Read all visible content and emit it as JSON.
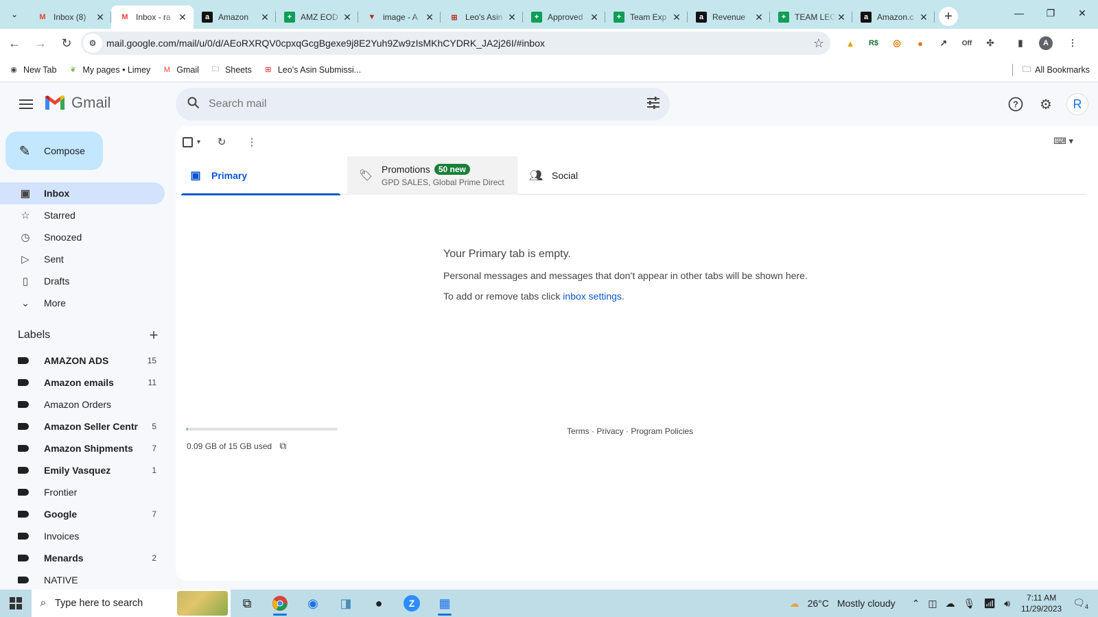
{
  "browser": {
    "tabs": [
      {
        "title": "Inbox (8)",
        "icon": "gmail-icon"
      },
      {
        "title": "Inbox - ra",
        "icon": "gmail-icon",
        "active": true
      },
      {
        "title": "Amazon",
        "icon": "amazon-icon"
      },
      {
        "title": "AMZ EOD",
        "icon": "sheets-icon"
      },
      {
        "title": "image - A",
        "icon": "vivaldi-icon"
      },
      {
        "title": "Leo's Asin",
        "icon": "form-icon"
      },
      {
        "title": "Approved",
        "icon": "sheets-icon"
      },
      {
        "title": "Team Exp",
        "icon": "sheets-icon"
      },
      {
        "title": "Revenue",
        "icon": "amazon-icon"
      },
      {
        "title": "TEAM LEO",
        "icon": "sheets-icon"
      },
      {
        "title": "Amazon.c",
        "icon": "amazon-icon"
      }
    ],
    "url": "mail.google.com/mail/u/0/d/AEoRXRQV0cpxqGcgBgexe9j8E2Yuh9Zw9zIsMKhCYDRK_JA2j26I/#inbox",
    "bookmarks": [
      {
        "label": "New Tab",
        "icon": "chrome-icon"
      },
      {
        "label": "My pages • Limey",
        "icon": "limey-icon"
      },
      {
        "label": "Gmail",
        "icon": "gmail-icon"
      },
      {
        "label": "Sheets",
        "icon": "folder-icon"
      },
      {
        "label": "Leo's Asin Submissi...",
        "icon": "form-icon"
      }
    ],
    "all_bookmarks": "All Bookmarks"
  },
  "gmail": {
    "logo_text": "Gmail",
    "search_placeholder": "Search mail",
    "avatar_letter": "R",
    "compose_label": "Compose",
    "nav": [
      {
        "label": "Inbox",
        "icon": "inbox-icon",
        "active": true
      },
      {
        "label": "Starred",
        "icon": "star-icon"
      },
      {
        "label": "Snoozed",
        "icon": "clock-icon"
      },
      {
        "label": "Sent",
        "icon": "send-icon"
      },
      {
        "label": "Drafts",
        "icon": "draft-icon"
      },
      {
        "label": "More",
        "icon": "chevron-down-icon"
      }
    ],
    "labels_title": "Labels",
    "labels": [
      {
        "name": "AMAZON ADS",
        "count": "15",
        "bold": true
      },
      {
        "name": "Amazon emails",
        "count": "11",
        "bold": true
      },
      {
        "name": "Amazon Orders",
        "count": "",
        "bold": false
      },
      {
        "name": "Amazon Seller Centr",
        "count": "5",
        "bold": true
      },
      {
        "name": "Amazon Shipments",
        "count": "7",
        "bold": true
      },
      {
        "name": "Emily Vasquez",
        "count": "1",
        "bold": true
      },
      {
        "name": "Frontier",
        "count": "",
        "bold": false
      },
      {
        "name": "Google",
        "count": "7",
        "bold": true
      },
      {
        "name": "Invoices",
        "count": "",
        "bold": false
      },
      {
        "name": "Menards",
        "count": "2",
        "bold": true
      },
      {
        "name": "NATIVE",
        "count": "",
        "bold": false
      }
    ],
    "tabs": {
      "primary": "Primary",
      "promotions": "Promotions",
      "promotions_badge": "50 new",
      "promotions_senders": "GPD SALES, Global Prime Direct",
      "social": "Social"
    },
    "empty": {
      "title": "Your Primary tab is empty.",
      "line1": "Personal messages and messages that don’t appear in other tabs will be shown here.",
      "line2_prefix": "To add or remove tabs click ",
      "line2_link": "inbox settings",
      "line2_suffix": "."
    },
    "storage": {
      "text": "0.09 GB of 15 GB used",
      "fraction": 0.006
    },
    "footer": {
      "terms": "Terms",
      "privacy": "Privacy",
      "policies": "Program Policies"
    }
  },
  "taskbar": {
    "search_placeholder": "Type here to search",
    "weather_temp": "26°C",
    "weather_desc": "Mostly cloudy",
    "time": "7:11 AM",
    "date": "11/29/2023",
    "notifications": "4"
  }
}
